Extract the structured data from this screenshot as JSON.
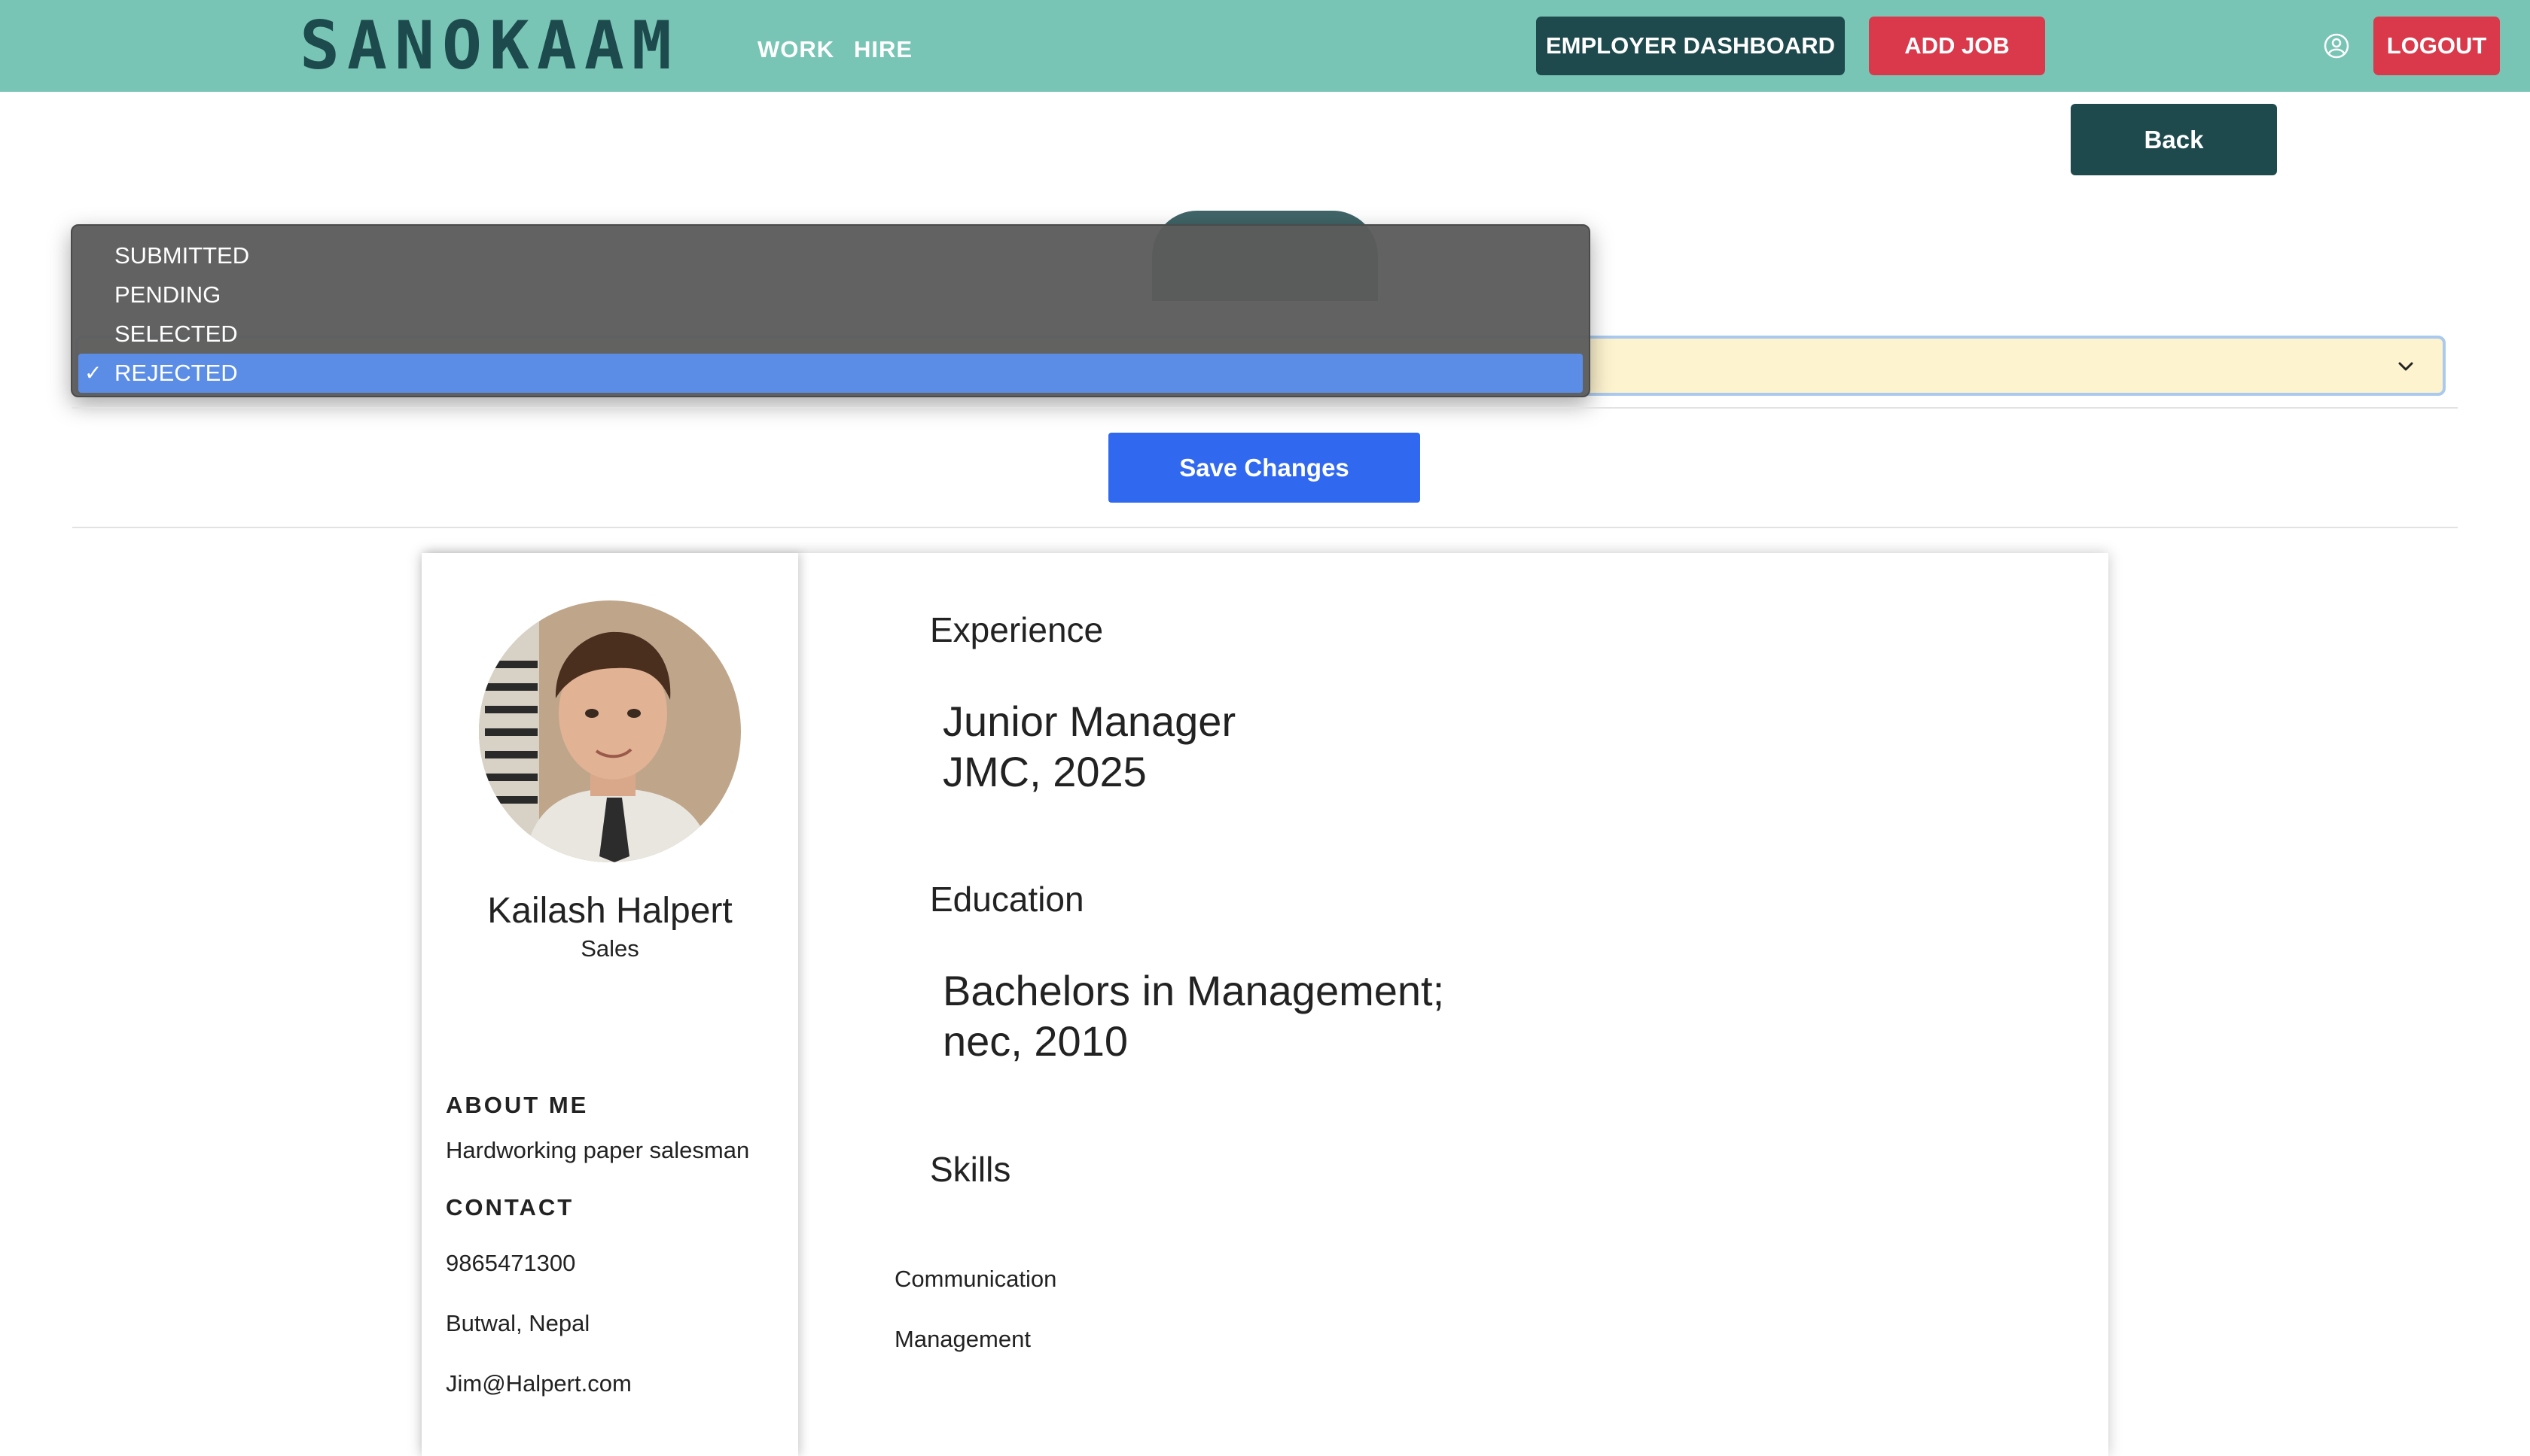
{
  "navbar": {
    "brand": "SANOKAAM",
    "links": [
      "WORK",
      "HIRE"
    ],
    "employer_dashboard": "EMPLOYER DASHBOARD",
    "add_job": "ADD JOB",
    "logout": "LOGOUT",
    "user_icon": "user-circle-icon"
  },
  "back_label": "Back",
  "status": {
    "options": [
      "SUBMITTED",
      "PENDING",
      "SELECTED",
      "REJECTED"
    ],
    "selected": "REJECTED",
    "check": "✓"
  },
  "save_label": "Save Changes",
  "profile": {
    "name": "Kailash Halpert",
    "role": "Sales",
    "about_heading": "ABOUT ME",
    "about": "Hardworking paper salesman",
    "contact_heading": "CONTACT",
    "phone": "9865471300",
    "location": "Butwal, Nepal",
    "email": "Jim@Halpert.com"
  },
  "experience": {
    "heading": "Experience",
    "line1": "Junior Manager",
    "line2": "JMC, 2025"
  },
  "education": {
    "heading": "Education",
    "line1": "Bachelors in Management;",
    "line2": "nec, 2010"
  },
  "skills": {
    "heading": "Skills",
    "items": [
      "Communication",
      "Management"
    ]
  },
  "colors": {
    "navbar": "#79c5b5",
    "dark_teal": "#1e4a4e",
    "red": "#d9394a",
    "blue": "#3068f0",
    "select_bg": "#fdf3cf"
  }
}
